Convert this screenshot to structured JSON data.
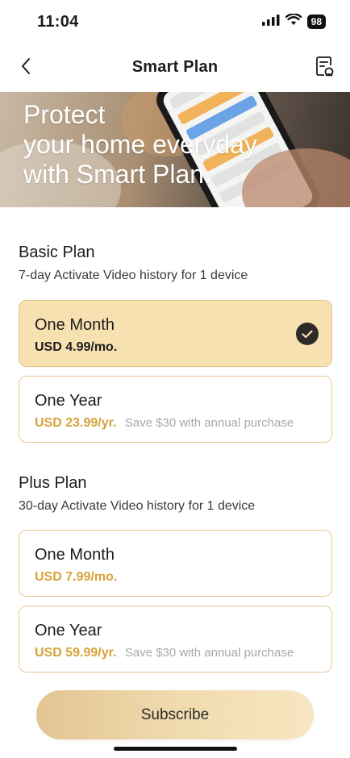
{
  "status_bar": {
    "time": "11:04",
    "battery": "98",
    "icons": [
      "cellular-icon",
      "wifi-icon",
      "battery-icon"
    ]
  },
  "nav": {
    "title": "Smart Plan",
    "back_icon": "chevron-left-icon",
    "record_icon": "record-document-icon"
  },
  "banner": {
    "line1": "Protect",
    "line2": "your home everyday",
    "line3": "with Smart Plan."
  },
  "basic_plan": {
    "title": "Basic Plan",
    "description": "7-day Activate Video history for 1 device",
    "options": [
      {
        "name": "One Month",
        "price": "USD 4.99/mo.",
        "save": "",
        "selected": true
      },
      {
        "name": "One Year",
        "price": "USD 23.99/yr.",
        "save": "Save $30 with annual purchase",
        "selected": false
      }
    ]
  },
  "plus_plan": {
    "title": "Plus Plan",
    "description": "30-day Activate Video history for 1 device",
    "options": [
      {
        "name": "One Month",
        "price": "USD 7.99/mo.",
        "save": "",
        "selected": false
      },
      {
        "name": "One Year",
        "price": "USD 59.99/yr.",
        "save": "Save $30 with annual purchase",
        "selected": false
      }
    ]
  },
  "subscribe_label": "Subscribe",
  "colors": {
    "accent": "#d6a23a",
    "selected_bg": "#f8e1b1",
    "border": "#e9c98e",
    "button_gradient_start": "#e3c592",
    "button_gradient_end": "#f7e6c2"
  }
}
